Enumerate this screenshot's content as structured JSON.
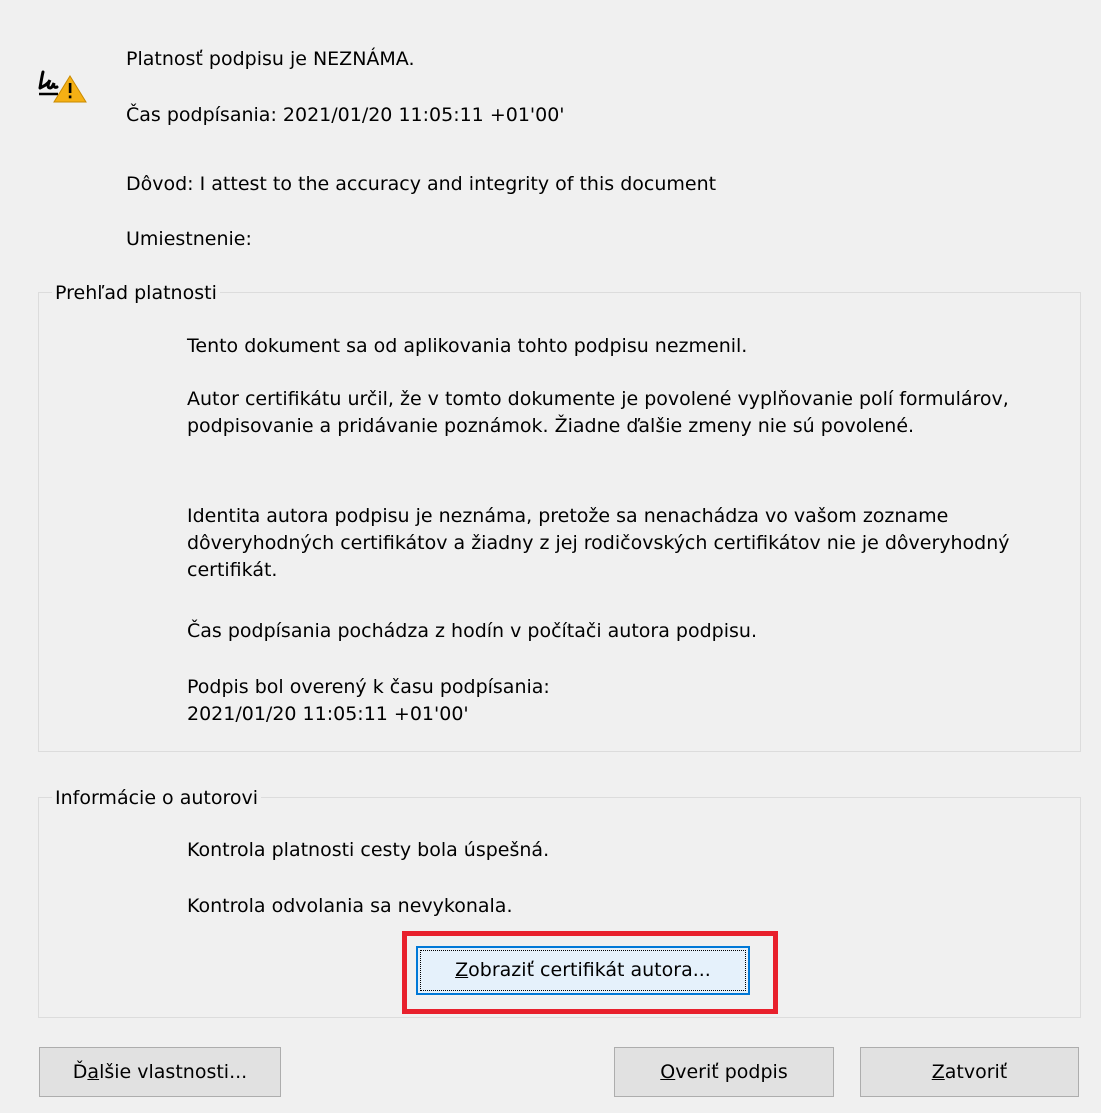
{
  "header": {
    "status": "Platnosť podpisu je NEZNÁMA.",
    "signing_time_label": "Čas podpísania:",
    "signing_time_value": "2021/01/20 11:05:11 +01'00'",
    "reason_label": "Dôvod:",
    "reason_value": "I attest to the accuracy and integrity of this document",
    "location_label": "Umiestnenie:",
    "icon": "signature-warning-icon"
  },
  "validity_summary": {
    "legend": "Prehľad platnosti",
    "paragraphs": [
      "Tento dokument sa od aplikovania tohto podpisu nezmenil.",
      "Autor certifikátu určil, že v tomto dokumente je povolené vyplňovanie polí formulárov, podpisovanie a pridávanie poznámok. Žiadne ďalšie zmeny nie sú povolené.",
      "Identita autora podpisu je neznáma, pretože sa nenachádza vo vašom zozname dôveryhodných certifikátov a žiadny z jej rodičovských certifikátov nie je dôveryhodný certifikát.",
      "Čas podpísania pochádza z hodín v počítači autora podpisu.",
      "Podpis bol overený k času podpísania:"
    ],
    "verified_time": "2021/01/20 11:05:11 +01'00'"
  },
  "author_info": {
    "legend": "Informácie o autorovi",
    "path_check": "Kontrola platnosti cesty bola úspešná.",
    "revocation_check": "Kontrola odvolania sa nevykonala.",
    "view_cert_button": {
      "mnemonic": "Z",
      "rest": "obraziť certifikát autora..."
    }
  },
  "footer": {
    "more_properties": {
      "pre": "Ď",
      "mnemonic": "a",
      "rest": "lšie vlastnosti..."
    },
    "verify": {
      "mnemonic": "O",
      "rest": "veriť podpis"
    },
    "close": {
      "mnemonic": "Z",
      "rest": "atvoriť"
    }
  },
  "colors": {
    "background": "#f0f0f0",
    "highlight_frame": "#e8202c",
    "focus_border": "#0078d7",
    "warning_triangle": "#f5b014"
  }
}
